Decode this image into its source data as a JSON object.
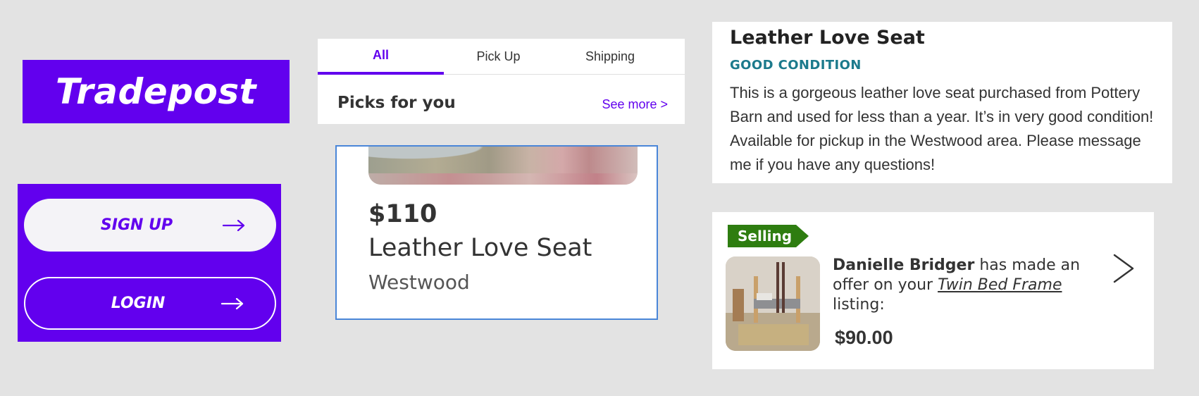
{
  "brand": {
    "name": "Tradepost",
    "accent": "#6200ee"
  },
  "auth": {
    "signup_label": "SIGN UP",
    "login_label": "LOGIN",
    "arrow_icon": "arrow-right-icon"
  },
  "tabs": {
    "items": [
      {
        "label": "All",
        "active": true
      },
      {
        "label": "Pick Up",
        "active": false
      },
      {
        "label": "Shipping",
        "active": false
      }
    ],
    "section_title": "Picks for you",
    "see_more": "See more >"
  },
  "listing": {
    "price": "$110",
    "title": "Leather Love Seat",
    "location": "Westwood"
  },
  "description": {
    "title": "Leather Love Seat",
    "condition": "GOOD CONDITION",
    "body": "This is a gorgeous leather love seat purchased from Pottery Barn and used for less than a year. It’s in very good condition! Available for pickup in the Westwood area. Please message me if you have any questions!"
  },
  "offer": {
    "badge": "Selling",
    "badge_color": "#2e7d10",
    "buyer": "Danielle Bridger",
    "text_mid": " has made an offer on your ",
    "item": "Twin Bed Frame",
    "text_end": " listing:",
    "amount": "$90.00",
    "chevron_icon": "chevron-right-icon"
  }
}
